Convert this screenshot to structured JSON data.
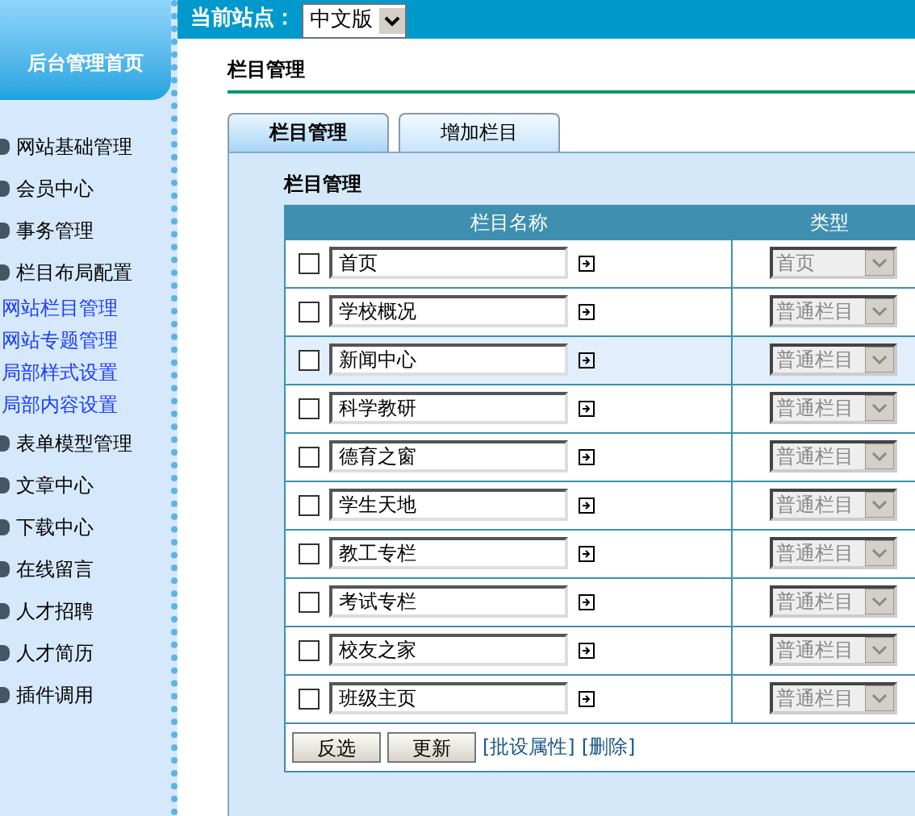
{
  "top_bar": {
    "site_label": "当前站点：",
    "site_select": "中文版"
  },
  "sidebar": {
    "home": "后台管理首页",
    "items": [
      {
        "label": "网站基础管理"
      },
      {
        "label": "会员中心"
      },
      {
        "label": "事务管理"
      },
      {
        "label": "栏目布局配置",
        "children": [
          {
            "label": "网站栏目管理"
          },
          {
            "label": "网站专题管理"
          },
          {
            "label": "局部样式设置"
          },
          {
            "label": "局部内容设置"
          }
        ]
      },
      {
        "label": "表单模型管理"
      },
      {
        "label": "文章中心"
      },
      {
        "label": "下载中心"
      },
      {
        "label": "在线留言"
      },
      {
        "label": "人才招聘"
      },
      {
        "label": "人才简历"
      },
      {
        "label": "插件调用"
      }
    ]
  },
  "page_title": "栏目管理",
  "tabs": [
    {
      "label": "栏目管理",
      "selected": true
    },
    {
      "label": "增加栏目",
      "selected": false
    }
  ],
  "panel_title": "栏目管理",
  "table": {
    "columns": [
      "栏目名称",
      "类型"
    ],
    "rows": [
      {
        "checked": false,
        "name": "首页",
        "type": "首页",
        "highlighted": false
      },
      {
        "checked": false,
        "name": "学校概况",
        "type": "普通栏目",
        "highlighted": false
      },
      {
        "checked": false,
        "name": "新闻中心",
        "type": "普通栏目",
        "highlighted": true
      },
      {
        "checked": false,
        "name": "科学教研",
        "type": "普通栏目",
        "highlighted": false
      },
      {
        "checked": false,
        "name": "德育之窗",
        "type": "普通栏目",
        "highlighted": false
      },
      {
        "checked": false,
        "name": "学生天地",
        "type": "普通栏目",
        "highlighted": false
      },
      {
        "checked": false,
        "name": "教工专栏",
        "type": "普通栏目",
        "highlighted": false
      },
      {
        "checked": false,
        "name": "考试专栏",
        "type": "普通栏目",
        "highlighted": false
      },
      {
        "checked": false,
        "name": "校友之家",
        "type": "普通栏目",
        "highlighted": false
      },
      {
        "checked": false,
        "name": "班级主页",
        "type": "普通栏目",
        "highlighted": false
      }
    ]
  },
  "actions": {
    "buttons": [
      "反选",
      "更新"
    ],
    "links": [
      "[批设属性]",
      "[删除]"
    ]
  }
}
